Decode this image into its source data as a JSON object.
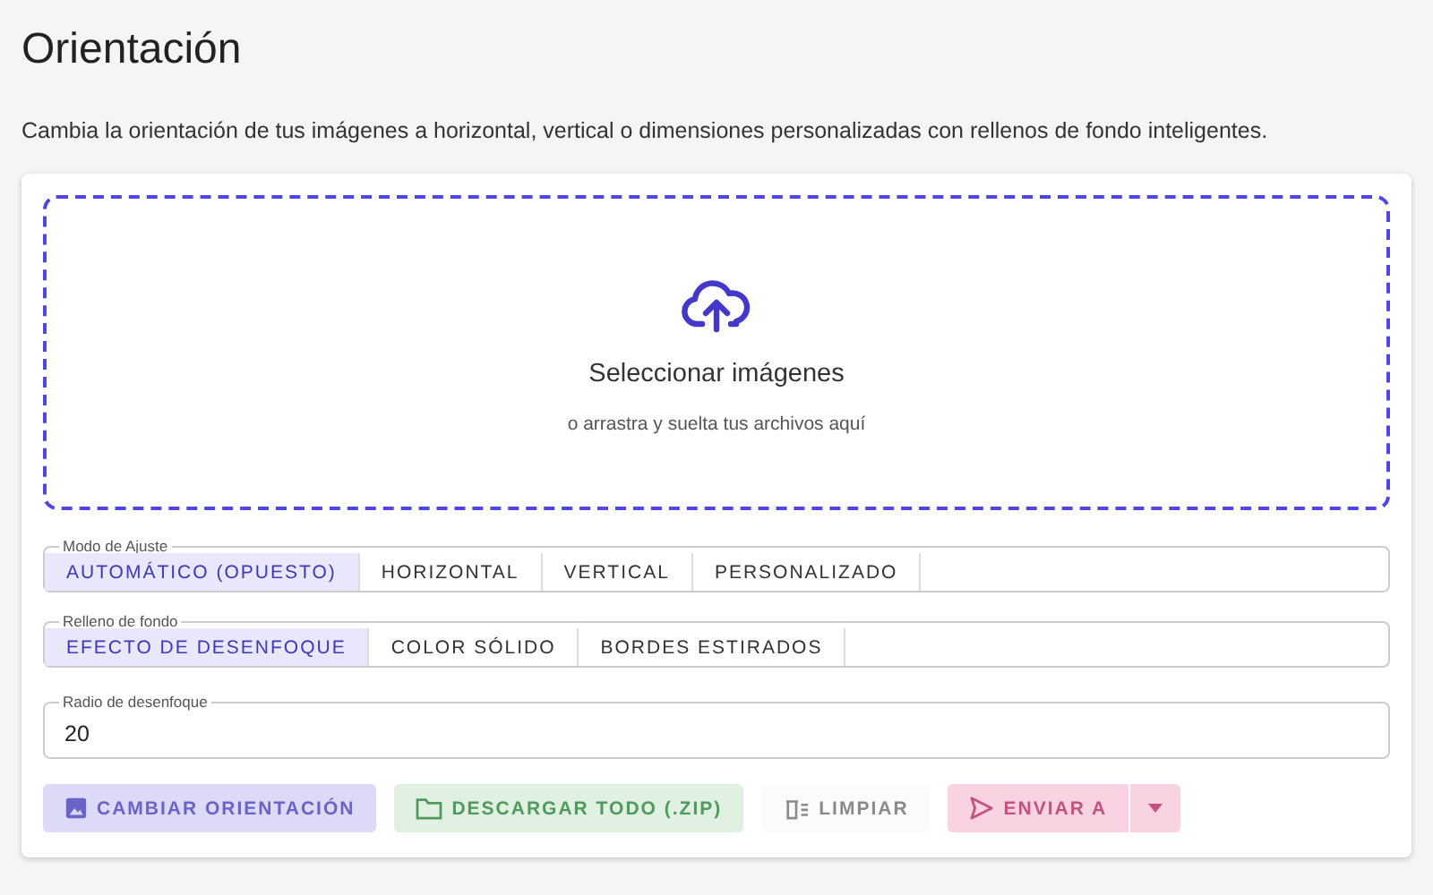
{
  "title": "Orientación",
  "description": "Cambia la orientación de tus imágenes a horizontal, vertical o dimensiones personalizadas con rellenos de fondo inteligentes.",
  "dropzone": {
    "title": "Seleccionar imágenes",
    "hint": "o arrastra y suelta tus archivos aquí"
  },
  "toggle_groups": [
    {
      "label": "Modo de Ajuste",
      "options": [
        {
          "label": "AUTOMÁTICO (OPUESTO)",
          "selected": true
        },
        {
          "label": "HORIZONTAL",
          "selected": false
        },
        {
          "label": "VERTICAL",
          "selected": false
        },
        {
          "label": "PERSONALIZADO",
          "selected": false
        }
      ]
    },
    {
      "label": "Relleno de fondo",
      "options": [
        {
          "label": "EFECTO DE DESENFOQUE",
          "selected": true
        },
        {
          "label": "COLOR SÓLIDO",
          "selected": false
        },
        {
          "label": "BORDES ESTIRADOS",
          "selected": false
        }
      ]
    }
  ],
  "blur_field": {
    "label": "Radio de desenfoque",
    "value": "20"
  },
  "buttons": [
    {
      "kind": "primary",
      "label": "CAMBIAR ORIENTACIÓN",
      "disabled": true
    },
    {
      "kind": "success",
      "label": "DESCARGAR TODO (.ZIP)",
      "disabled": true
    },
    {
      "kind": "plain",
      "label": "LIMPIAR",
      "disabled": true
    },
    {
      "kind": "secondary",
      "label": "ENVIAR A",
      "disabled": true,
      "split": true
    }
  ]
}
